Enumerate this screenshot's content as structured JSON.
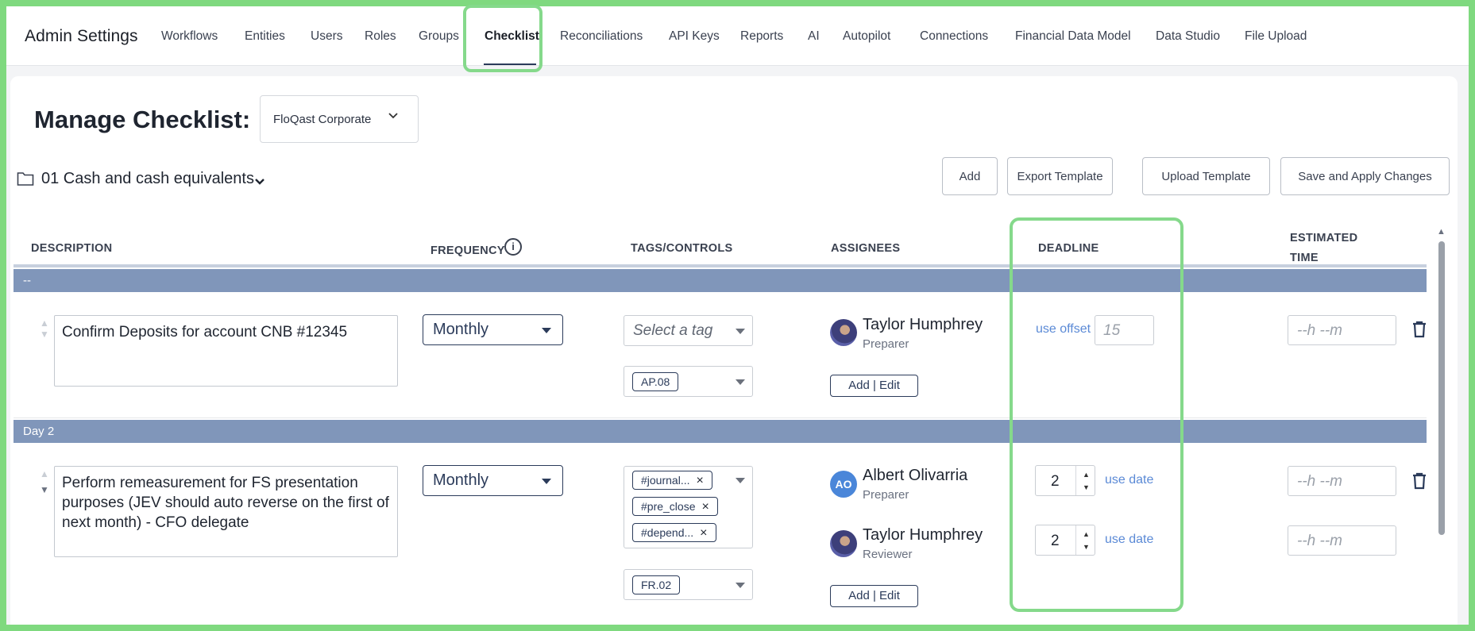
{
  "nav": {
    "brand": "Admin Settings",
    "items": [
      "Workflows",
      "Entities",
      "Users",
      "Roles",
      "Groups",
      "Checklist",
      "Reconciliations",
      "API Keys",
      "Reports",
      "AI",
      "Autopilot",
      "Connections",
      "Financial Data Model",
      "Data Studio",
      "File Upload"
    ],
    "active": "Checklist"
  },
  "page": {
    "title": "Manage Checklist:",
    "entity": "FloQast Corporate",
    "folder": "01 Cash and cash equivalents"
  },
  "toolbar": {
    "add": "Add",
    "export": "Export Template",
    "upload": "Upload Template",
    "save": "Save and Apply Changes"
  },
  "table": {
    "headers": {
      "description": "DESCRIPTION",
      "frequency": "FREQUENCY",
      "tags": "TAGS/CONTROLS",
      "assignees": "ASSIGNEES",
      "deadline": "DEADLINE",
      "estimated_time_1": "ESTIMATED",
      "estimated_time_2": "TIME"
    },
    "sections": [
      {
        "label": "--",
        "rows": [
          {
            "description": "Confirm Deposits for account CNB #12345",
            "frequency": "Monthly",
            "tag_placeholder": "Select a tag",
            "tags": [],
            "control": "AP.08",
            "assignees": [
              {
                "name": "Taylor Humphrey",
                "role": "Preparer",
                "avatar": "photo"
              }
            ],
            "add_edit": "Add | Edit",
            "deadline_link": "use offset",
            "deadline_value": "15",
            "est_placeholder": "--h --m"
          }
        ]
      },
      {
        "label": "Day 2",
        "rows": [
          {
            "description": "Perform remeasurement for FS presentation purposes (JEV should auto reverse on the first of next month) - CFO delegate",
            "frequency": "Monthly",
            "tags": [
              "#journal...",
              "#pre_close",
              "#depend..."
            ],
            "control": "FR.02",
            "assignees": [
              {
                "name": "Albert Olivarria",
                "role": "Preparer",
                "initials": "AO",
                "deadline": "2",
                "link": "use date"
              },
              {
                "name": "Taylor Humphrey",
                "role": "Reviewer",
                "avatar": "photo",
                "deadline": "2",
                "link": "use date"
              }
            ],
            "add_edit": "Add | Edit",
            "est_placeholder": "--h --m"
          }
        ]
      }
    ]
  },
  "colors": {
    "highlight": "#85d98b",
    "section_bar": "#8096ba",
    "primary": "#2b3b5a",
    "link": "#5b8ad6"
  }
}
